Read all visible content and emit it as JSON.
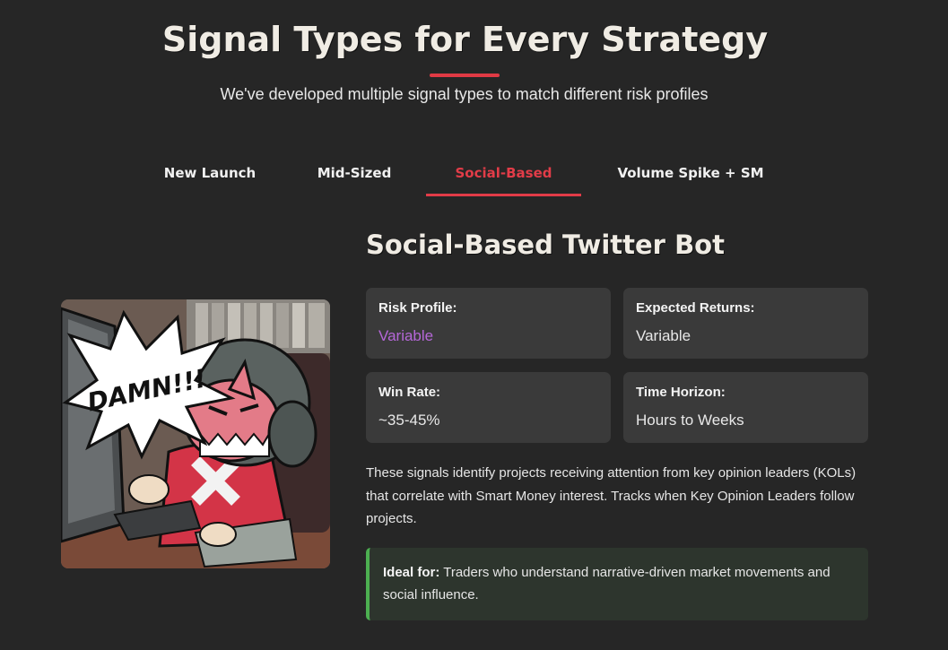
{
  "section": {
    "title": "Signal Types for Every Strategy",
    "subtitle": "We've developed multiple signal types to match different risk profiles"
  },
  "tabs": [
    {
      "label": "New Launch",
      "active": false
    },
    {
      "label": "Mid-Sized",
      "active": false
    },
    {
      "label": "Social-Based",
      "active": true
    },
    {
      "label": "Volume Spike + SM",
      "active": false
    }
  ],
  "card": {
    "title": "Social-Based Twitter Bot",
    "art_text": "DAMN!!!",
    "stats": [
      {
        "label": "Risk Profile:",
        "value": "Variable"
      },
      {
        "label": "Expected Returns:",
        "value": "Variable"
      },
      {
        "label": "Win Rate:",
        "value": "~35-45%"
      },
      {
        "label": "Time Horizon:",
        "value": "Hours to Weeks"
      }
    ],
    "description": "These signals identify projects receiving attention from key opinion leaders (KOLs) that correlate with Smart Money interest. Tracks when Key Opinion Leaders follow projects.",
    "ideal_label": "Ideal for:",
    "ideal_text": " Traders who understand narrative-driven market movements and social influence."
  },
  "colors": {
    "background": "#262626",
    "accent_red": "#e23c48",
    "stat_purple": "#b567d8",
    "ideal_green": "#4caf50"
  }
}
